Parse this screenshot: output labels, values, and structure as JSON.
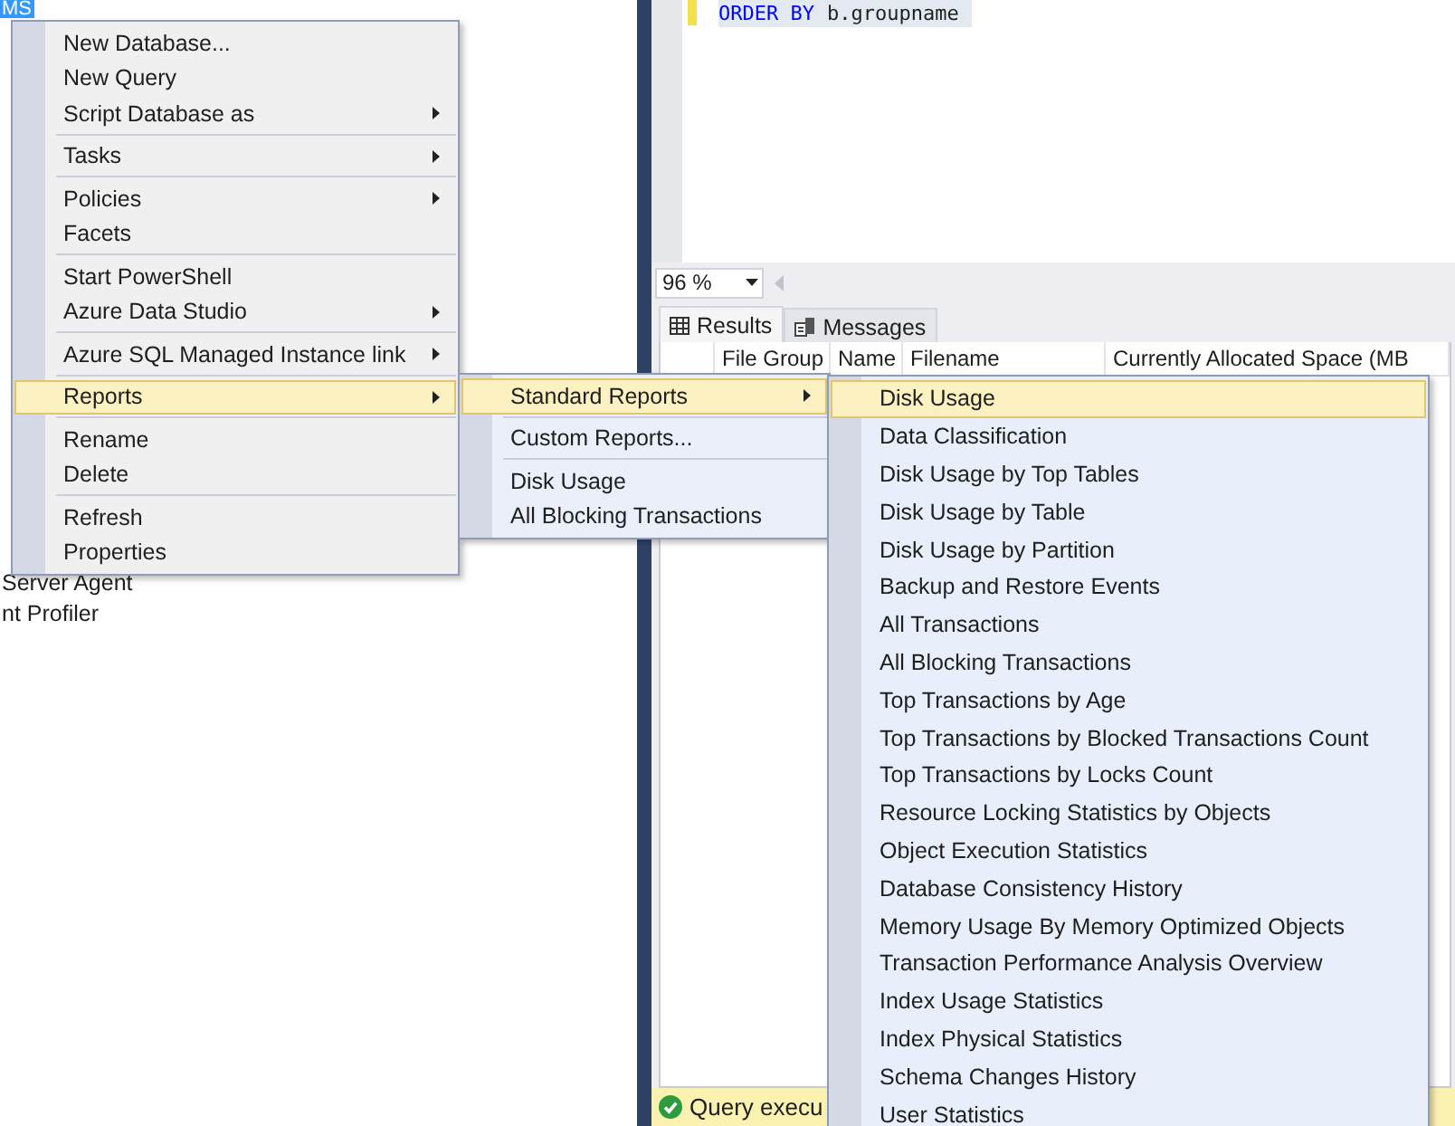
{
  "object_explorer": {
    "items": [
      {
        "label": "MS",
        "selected": true
      },
      {
        "label": "Server Agent",
        "selected": false
      },
      {
        "label": "nt Profiler",
        "selected": false
      }
    ]
  },
  "editor": {
    "code": [
      {
        "kind": "keyword",
        "text": "ORDER BY"
      },
      {
        "kind": "identifier",
        "text": "b.groupname"
      }
    ]
  },
  "zoom": {
    "value": "96 %"
  },
  "result_tabs": [
    {
      "label": "Results",
      "kind": "grid",
      "selected": true
    },
    {
      "label": "Messages",
      "kind": "messages",
      "selected": false
    }
  ],
  "grid": {
    "columns": [
      "File Group",
      "Name",
      "Filename",
      "Currently Allocated Space (MB"
    ]
  },
  "status_bar": {
    "text": "Query execu"
  },
  "context_menu": {
    "items": [
      {
        "kind": "item",
        "label": "New Database...",
        "submenu": false,
        "selected": false
      },
      {
        "kind": "item",
        "label": "New Query",
        "submenu": false,
        "selected": false
      },
      {
        "kind": "item",
        "label": "Script Database as",
        "submenu": true,
        "selected": false
      },
      {
        "kind": "separator"
      },
      {
        "kind": "item",
        "label": "Tasks",
        "submenu": true,
        "selected": false
      },
      {
        "kind": "separator"
      },
      {
        "kind": "item",
        "label": "Policies",
        "submenu": true,
        "selected": false
      },
      {
        "kind": "item",
        "label": "Facets",
        "submenu": false,
        "selected": false
      },
      {
        "kind": "separator"
      },
      {
        "kind": "item",
        "label": "Start PowerShell",
        "submenu": false,
        "selected": false
      },
      {
        "kind": "item",
        "label": "Azure Data Studio",
        "submenu": true,
        "selected": false
      },
      {
        "kind": "separator"
      },
      {
        "kind": "item",
        "label": "Azure SQL Managed Instance link",
        "submenu": true,
        "selected": false
      },
      {
        "kind": "separator"
      },
      {
        "kind": "item",
        "label": "Reports",
        "submenu": true,
        "selected": true
      },
      {
        "kind": "separator"
      },
      {
        "kind": "item",
        "label": "Rename",
        "submenu": false,
        "selected": false
      },
      {
        "kind": "item",
        "label": "Delete",
        "submenu": false,
        "selected": false
      },
      {
        "kind": "separator"
      },
      {
        "kind": "item",
        "label": "Refresh",
        "submenu": false,
        "selected": false
      },
      {
        "kind": "item",
        "label": "Properties",
        "submenu": false,
        "selected": false
      }
    ]
  },
  "reports_submenu": {
    "items": [
      {
        "kind": "item",
        "label": "Standard Reports",
        "submenu": true,
        "selected": true
      },
      {
        "kind": "separator"
      },
      {
        "kind": "item",
        "label": "Custom Reports...",
        "submenu": false,
        "selected": false
      },
      {
        "kind": "separator"
      },
      {
        "kind": "item",
        "label": "Disk Usage",
        "submenu": false,
        "selected": false
      },
      {
        "kind": "item",
        "label": "All Blocking Transactions",
        "submenu": false,
        "selected": false
      }
    ]
  },
  "standard_reports_submenu": {
    "items": [
      {
        "kind": "item",
        "label": "Disk Usage",
        "submenu": false,
        "selected": true
      },
      {
        "kind": "item",
        "label": "Data Classification",
        "submenu": false,
        "selected": false
      },
      {
        "kind": "item",
        "label": "Disk Usage by Top Tables",
        "submenu": false,
        "selected": false
      },
      {
        "kind": "item",
        "label": "Disk Usage by Table",
        "submenu": false,
        "selected": false
      },
      {
        "kind": "item",
        "label": "Disk Usage by Partition",
        "submenu": false,
        "selected": false
      },
      {
        "kind": "item",
        "label": "Backup and Restore Events",
        "submenu": false,
        "selected": false
      },
      {
        "kind": "item",
        "label": "All Transactions",
        "submenu": false,
        "selected": false
      },
      {
        "kind": "item",
        "label": "All Blocking Transactions",
        "submenu": false,
        "selected": false
      },
      {
        "kind": "item",
        "label": "Top Transactions by Age",
        "submenu": false,
        "selected": false
      },
      {
        "kind": "item",
        "label": "Top Transactions by Blocked Transactions Count",
        "submenu": false,
        "selected": false
      },
      {
        "kind": "item",
        "label": "Top Transactions by Locks Count",
        "submenu": false,
        "selected": false
      },
      {
        "kind": "item",
        "label": "Resource Locking Statistics by Objects",
        "submenu": false,
        "selected": false
      },
      {
        "kind": "item",
        "label": "Object Execution Statistics",
        "submenu": false,
        "selected": false
      },
      {
        "kind": "item",
        "label": "Database Consistency History",
        "submenu": false,
        "selected": false
      },
      {
        "kind": "item",
        "label": "Memory Usage By Memory Optimized Objects",
        "submenu": false,
        "selected": false
      },
      {
        "kind": "item",
        "label": "Transaction Performance Analysis Overview",
        "submenu": false,
        "selected": false
      },
      {
        "kind": "item",
        "label": "Index Usage Statistics",
        "submenu": false,
        "selected": false
      },
      {
        "kind": "item",
        "label": "Index Physical Statistics",
        "submenu": false,
        "selected": false
      },
      {
        "kind": "item",
        "label": "Schema Changes History",
        "submenu": false,
        "selected": false
      },
      {
        "kind": "item",
        "label": "User Statistics",
        "submenu": false,
        "selected": false
      }
    ]
  }
}
